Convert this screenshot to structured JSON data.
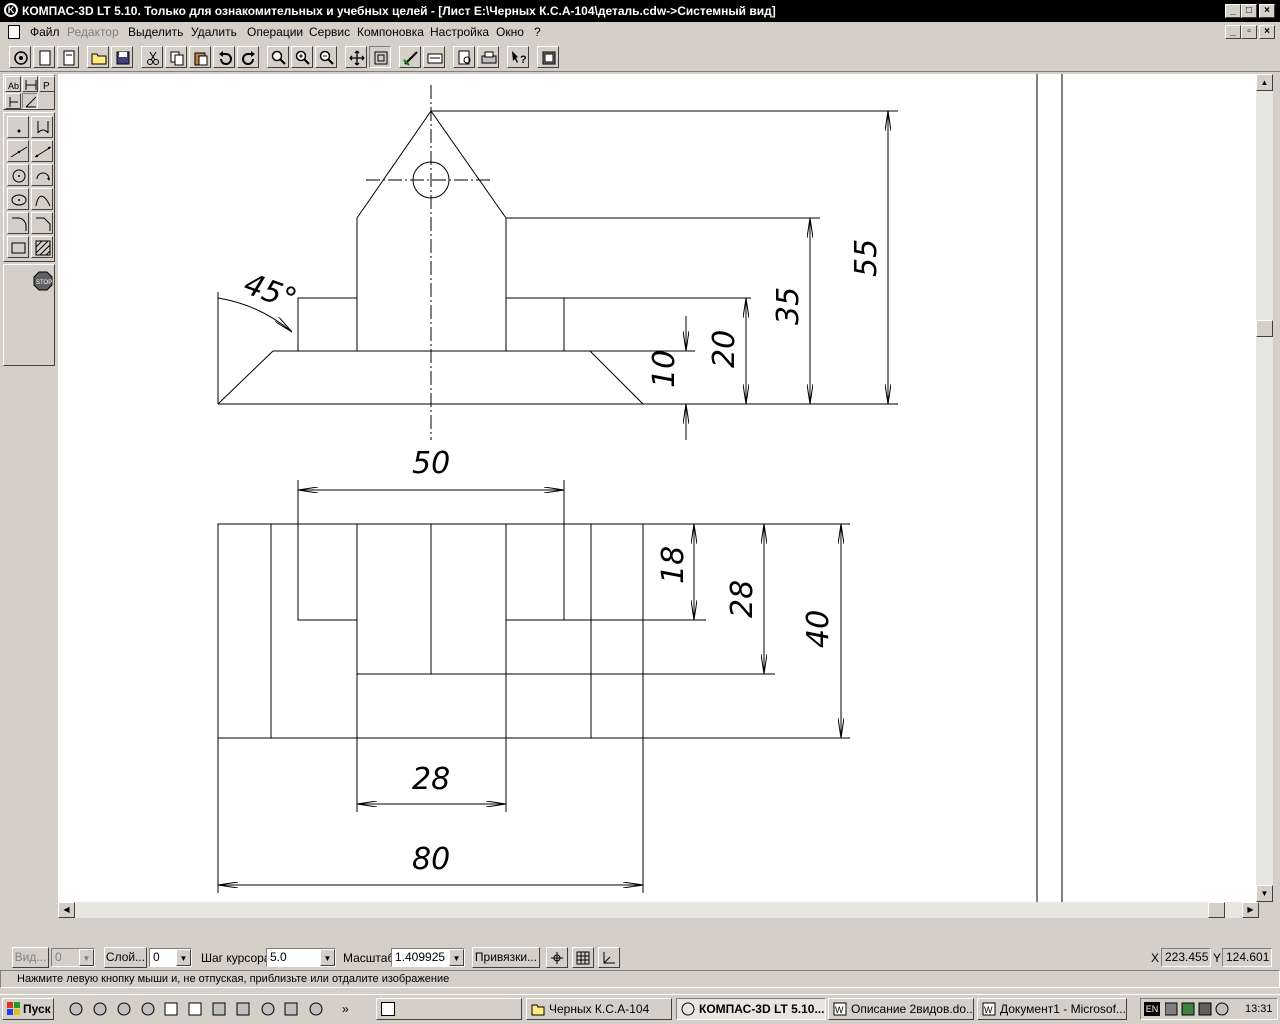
{
  "window": {
    "title": "КОМПАС-3D LT 5.10. Только для ознакомительных и учебных целей - [Лист E:\\Черных К.С.А-104\\деталь.cdw->Системный вид]",
    "logo": "K"
  },
  "menu": [
    "Файл",
    "Редактор",
    "Выделить",
    "Удалить",
    "Операции",
    "Сервис",
    "Компоновка",
    "Настройка",
    "Окно",
    "?"
  ],
  "drawing": {
    "dims": {
      "d55": "55",
      "d35": "35",
      "d20": "20",
      "d10": "10",
      "angle": "45°",
      "d50": "50",
      "d18": "18",
      "d28v": "28",
      "d40": "40",
      "d28h": "28",
      "d80": "80"
    }
  },
  "propbar": {
    "view_button": "Вид...",
    "view_value": "0",
    "layer_button": "Слой...",
    "layer_value": "0",
    "step_label": "Шаг курсора",
    "step_value": "5.0",
    "scale_label": "Масштаб",
    "scale_value": "1.409925",
    "snap_button": "Привязки...",
    "x_label": "X",
    "x_value": "223.455",
    "y_label": "Y",
    "y_value": "124.601"
  },
  "status": "Нажмите левую кнопку мыши и, не отпуская, приблизьте или отдалите изображение",
  "taskbar": {
    "start": "Пуск",
    "tasks": [
      "Черных К.С.А-104",
      "КОМПАС-3D LT 5.10...",
      "Описание 2видов.do...",
      "Документ1 - Microsof..."
    ],
    "lang": "EN",
    "clock": "13:31"
  }
}
